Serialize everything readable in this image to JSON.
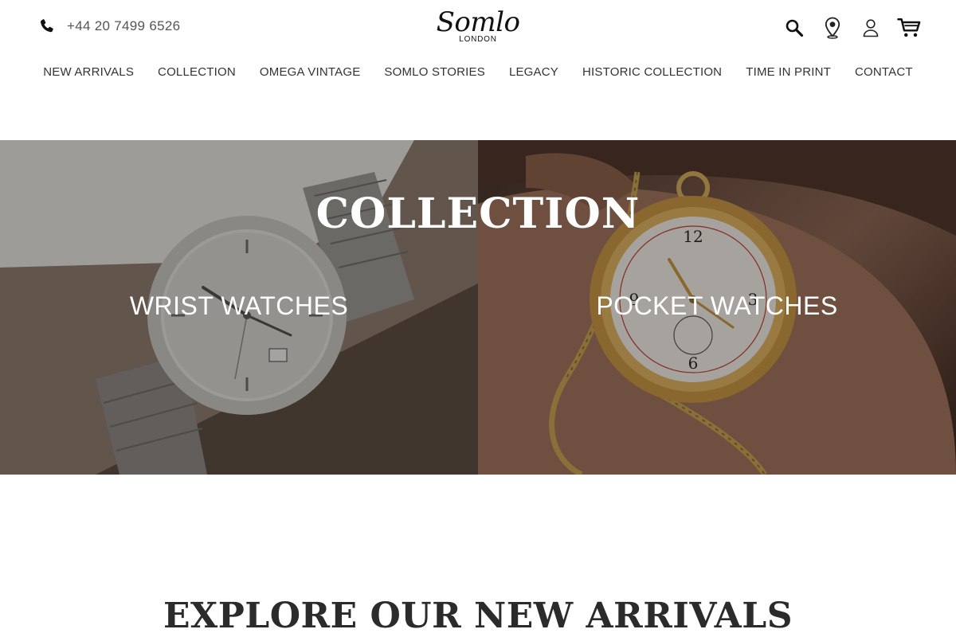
{
  "header": {
    "phone_number": "+44 20 7499 6526",
    "logo": {
      "name": "Somlo",
      "sub": "LONDON"
    },
    "icons": [
      "search-icon",
      "location-pin-icon",
      "user-icon",
      "cart-icon"
    ]
  },
  "nav": {
    "items": [
      {
        "label": "NEW ARRIVALS"
      },
      {
        "label": "COLLECTION"
      },
      {
        "label": "OMEGA VINTAGE"
      },
      {
        "label": "SOMLO STORIES"
      },
      {
        "label": "LEGACY"
      },
      {
        "label": "HISTORIC COLLECTION"
      },
      {
        "label": "TIME IN PRINT"
      },
      {
        "label": "CONTACT"
      }
    ]
  },
  "hero": {
    "title": "COLLECTION",
    "panels": [
      {
        "label": "WRIST WATCHES"
      },
      {
        "label": "POCKET WATCHES"
      }
    ]
  },
  "section": {
    "title": "EXPLORE OUR NEW ARRIVALS"
  },
  "colors": {
    "text": "#222222",
    "nav_text": "#333333",
    "overlay": "#1d1a17",
    "heading": "#2b2b2b"
  }
}
